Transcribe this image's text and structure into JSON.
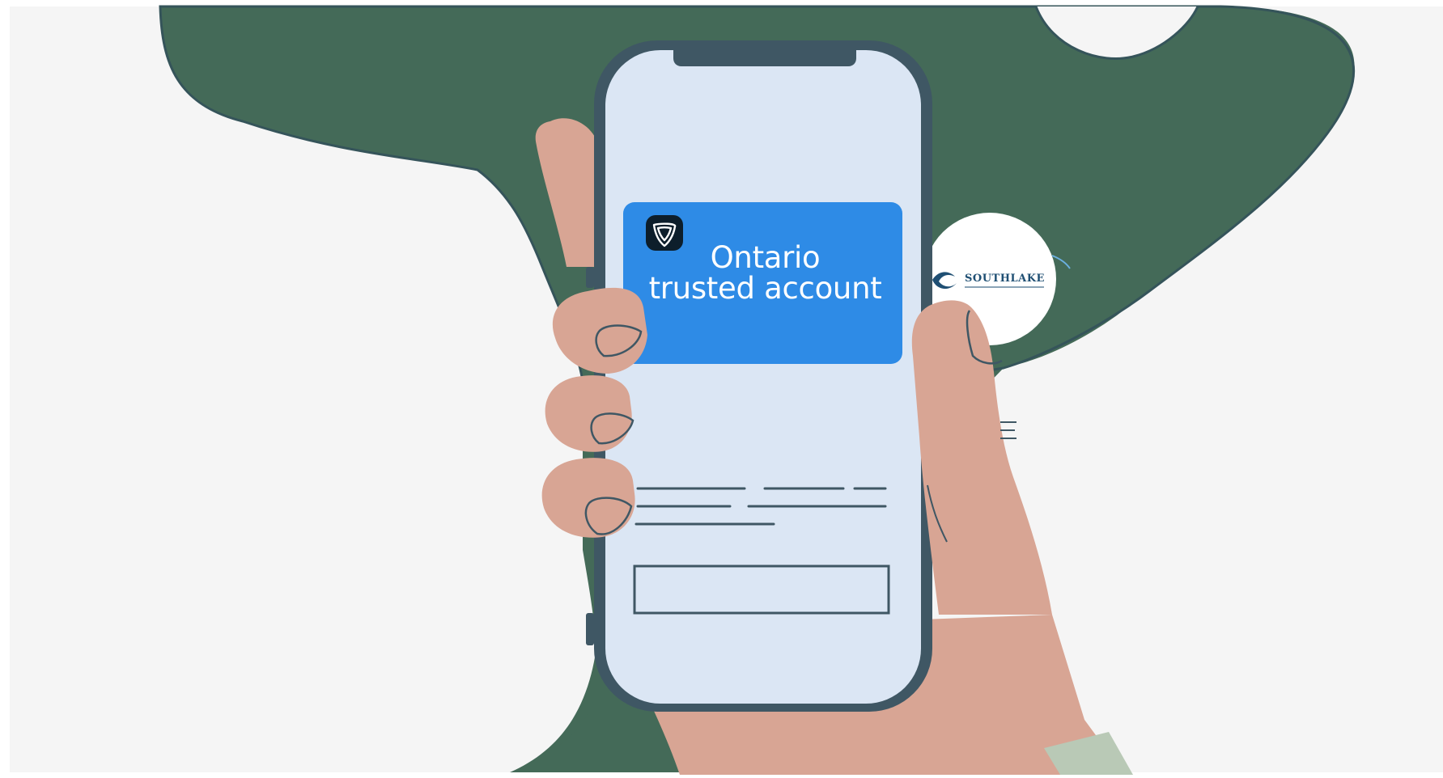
{
  "scene": {
    "colors": {
      "background": "#f5f5f5",
      "map_green": "#446a58",
      "map_outline": "#35545a",
      "phone_frame": "#3f5764",
      "phone_screen": "#dbe6f4",
      "card_blue": "#2e8be6",
      "skin": "#d8a594",
      "sleeve": "#b9c9b6"
    }
  },
  "card": {
    "line1": "Ontario",
    "line2": "trusted account",
    "logo_icon": "ontario-trillium-icon"
  },
  "partner": {
    "logo_text": "SOUTHLAKE",
    "logo_icon": "southlake-logo-icon"
  }
}
